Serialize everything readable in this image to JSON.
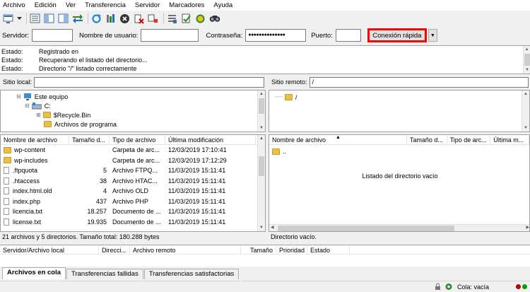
{
  "menu": [
    "Archivo",
    "Edición",
    "Ver",
    "Transferencia",
    "Servidor",
    "Marcadores",
    "Ayuda"
  ],
  "toolbar_icons": [
    "site-manager-icon",
    "dropdown-arrow-icon",
    "toggle-log-icon",
    "toggle-local-tree-icon",
    "toggle-remote-tree-icon",
    "toggle-queue-icon",
    "refresh-icon",
    "process-queue-icon",
    "cancel-icon",
    "disconnect-icon",
    "reconnect-icon",
    "filter-icon",
    "compare-icon",
    "sync-browse-icon",
    "search-icon"
  ],
  "quickconnect": {
    "server_label": "Servidor:",
    "server_value": "",
    "user_label": "Nombre de usuario:",
    "user_value": "",
    "password_label": "Contraseña:",
    "password_value": "●●●●●●●●●●●●●●",
    "port_label": "Puerto:",
    "port_value": "",
    "connect_button": "Conexión rápida",
    "dropdown": "▼"
  },
  "log": [
    {
      "key": "Estado:",
      "msg": "Registrado en"
    },
    {
      "key": "Estado:",
      "msg": "Recuperando el listado del directorio..."
    },
    {
      "key": "Estado:",
      "msg": "Directorio \"/\" listado correctamente"
    }
  ],
  "local": {
    "label": "Sitio local:",
    "path": "",
    "tree": [
      "Este equipo",
      "C:",
      "$Recycle.Bin",
      "Archivos de programa"
    ],
    "columns": [
      "Nombre de archivo",
      "Tamaño d...",
      "Tipo de archivo",
      "Última modificación"
    ],
    "files": [
      {
        "name": "wp-content",
        "size": "",
        "type": "Carpeta de arc...",
        "date": "12/03/2019 17:10:41",
        "folder": true
      },
      {
        "name": "wp-includes",
        "size": "",
        "type": "Carpeta de arc...",
        "date": "12/03/2019 17:12:29",
        "folder": true
      },
      {
        "name": ".ftpquota",
        "size": "5",
        "type": "Archivo FTPQ...",
        "date": "11/03/2019 15:11:41",
        "folder": false
      },
      {
        "name": ".htaccess",
        "size": "38",
        "type": "Archivo HTAC...",
        "date": "11/03/2019 15:11:41",
        "folder": false
      },
      {
        "name": "index.html.old",
        "size": "4",
        "type": "Archivo OLD",
        "date": "11/03/2019 15:11:41",
        "folder": false
      },
      {
        "name": "index.php",
        "size": "437",
        "type": "Archivo PHP",
        "date": "11/03/2019 15:11:41",
        "folder": false
      },
      {
        "name": "licencia.txt",
        "size": "18.257",
        "type": "Documento de ...",
        "date": "11/03/2019 15:11:41",
        "folder": false
      },
      {
        "name": "license.txt",
        "size": "19.935",
        "type": "Documento de ...",
        "date": "11/03/2019 15:11:41",
        "folder": false
      }
    ],
    "status": "21 archivos y 5 directorios. Tamaño total: 180.288 bytes"
  },
  "remote": {
    "label": "Sitio remoto:",
    "path": "/",
    "tree": [
      "/"
    ],
    "columns": [
      "Nombre de archivo",
      "Tamaño d...",
      "Tipo de arc...",
      "Última m..."
    ],
    "files": [
      {
        "name": ".."
      }
    ],
    "empty_msg": "Listado del directorio vacío",
    "status": "Directorio vacío."
  },
  "queue": {
    "columns": [
      "Servidor/Archivo local",
      "Direcci...",
      "Archivo remoto",
      "Tamaño",
      "Prioridad",
      "Estado"
    ],
    "tabs": [
      "Archivos en cola",
      "Transferencias fallidas",
      "Transferencias satisfactorias"
    ]
  },
  "statusbar": {
    "queue": "Cola: vacía"
  },
  "colors": {
    "highlight": "#ff0000",
    "folder": "#e8c04a",
    "led_red": "#c00000",
    "led_green": "#00a000"
  }
}
